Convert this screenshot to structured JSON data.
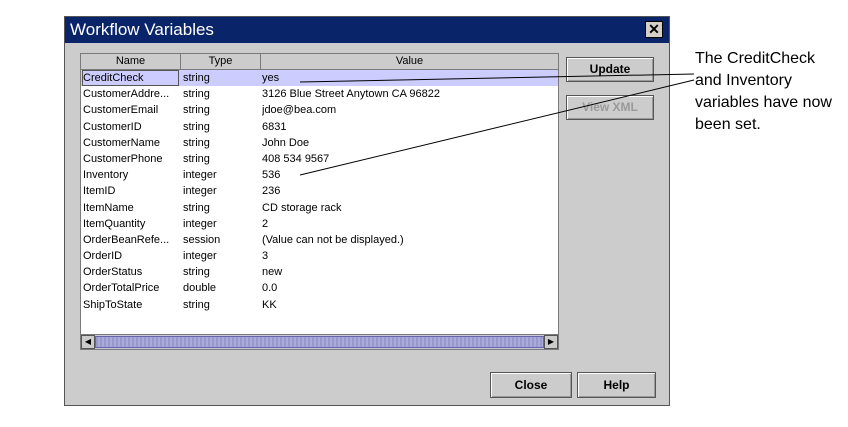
{
  "window": {
    "title": "Workflow Variables"
  },
  "table": {
    "columns": [
      "Name",
      "Type",
      "Value"
    ],
    "rows": [
      [
        "CreditCheck",
        "string",
        "yes"
      ],
      [
        "CustomerAddre...",
        "string",
        "3126 Blue Street Anytown CA 96822"
      ],
      [
        "CustomerEmail",
        "string",
        "jdoe@bea.com"
      ],
      [
        "CustomerID",
        "string",
        "6831"
      ],
      [
        "CustomerName",
        "string",
        "John Doe"
      ],
      [
        "CustomerPhone",
        "string",
        "408 534 9567"
      ],
      [
        "Inventory",
        "integer",
        "536"
      ],
      [
        "ItemID",
        "integer",
        "236"
      ],
      [
        "ItemName",
        "string",
        "CD storage rack"
      ],
      [
        "ItemQuantity",
        "integer",
        "2"
      ],
      [
        "OrderBeanRefe...",
        "session",
        "(Value can not be displayed.)"
      ],
      [
        "OrderID",
        "integer",
        "3"
      ],
      [
        "OrderStatus",
        "string",
        "new"
      ],
      [
        "OrderTotalPrice",
        "double",
        "0.0"
      ],
      [
        "ShipToState",
        "string",
        "KK"
      ]
    ],
    "selected_row": 0
  },
  "buttons": {
    "update": "Update",
    "view_xml": "View XML",
    "close": "Close",
    "help": "Help"
  },
  "annotation": "The CreditCheck and Inventory variables have now been set.",
  "colors": {
    "title_bar": "#0a246a",
    "dialog_bg": "#cccccc",
    "selection": "#ccccff"
  },
  "icons": {
    "close": "close-icon",
    "scroll_left": "arrow-left-icon",
    "scroll_right": "arrow-right-icon"
  }
}
